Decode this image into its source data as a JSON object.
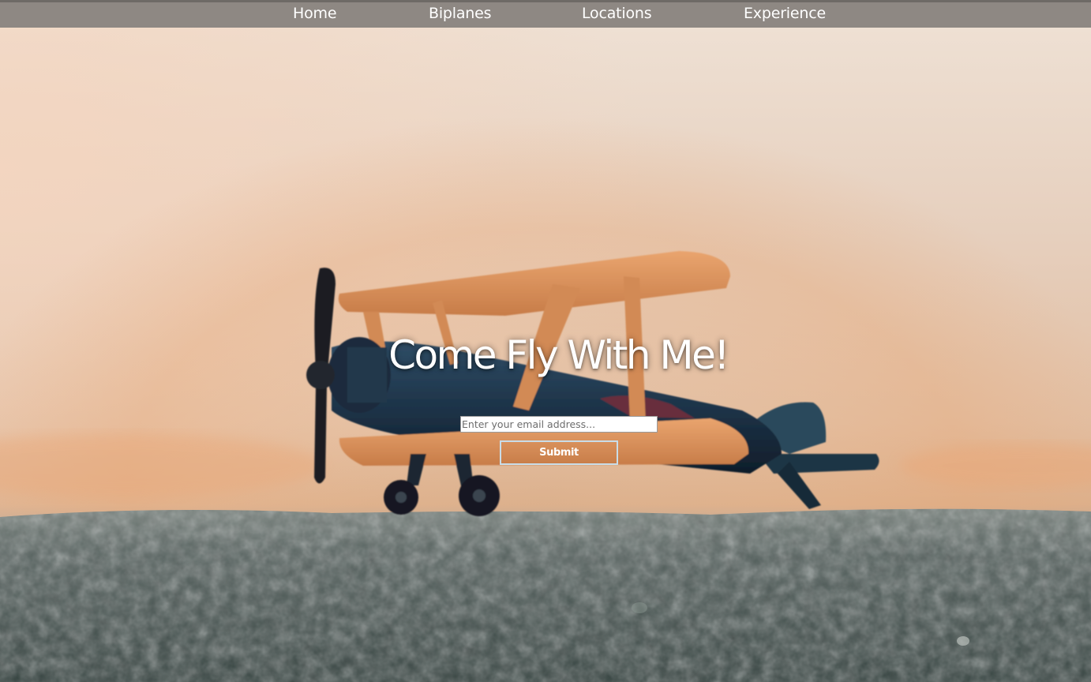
{
  "nav": {
    "items": [
      {
        "label": "Home"
      },
      {
        "label": "Biplanes"
      },
      {
        "label": "Locations"
      },
      {
        "label": "Experience"
      }
    ]
  },
  "hero": {
    "title": "Come Fly With Me!",
    "background_image": "blurred toy biplane on rough stone ledge at sunset"
  },
  "signup": {
    "email_placeholder": "Enter your email address...",
    "email_value": "",
    "submit_label": "Submit"
  },
  "colors": {
    "nav_bg": "#8e8883",
    "text": "#ffffff",
    "button_border": "#c9dde8",
    "sky_top": "#f1e0d2",
    "sky_horizon": "#e9b992",
    "stone": "#4d5a58"
  }
}
